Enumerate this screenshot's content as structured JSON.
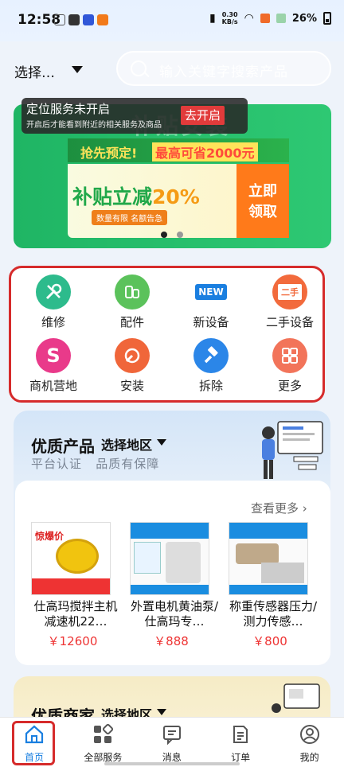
{
  "status_bar": {
    "time": "12:58",
    "speed": "0.30\nKB/s",
    "battery": "26%"
  },
  "top_bar": {
    "city_label": "选择…",
    "search_placeholder": "输入关键字搜索产品"
  },
  "banner": {
    "background_text": "补贴安装",
    "location_notice": {
      "title": "定位服务未开启",
      "subtitle": "开启后才能看到附近的相关服务及商品",
      "button": "去开启"
    },
    "promo_line_1": "抢先预定!",
    "promo_line_2": "最高可省2000元",
    "promo_main": "补贴立减",
    "promo_percent": "20%",
    "promo_note": "数量有限 名额告急",
    "promo_cta": "立即\n领取",
    "pages": 2,
    "active_page": 1
  },
  "services": [
    {
      "label": "维修",
      "icon": "wrench-icon",
      "color": "#2dbb8c"
    },
    {
      "label": "配件",
      "icon": "parts-icon",
      "color": "#5bc25b"
    },
    {
      "label": "新设备",
      "icon": "new-badge-icon",
      "color": "#1a7fe0"
    },
    {
      "label": "二手设备",
      "icon": "secondhand-icon",
      "color": "#f26a3c"
    },
    {
      "label": "商机营地",
      "icon": "shop-bag-icon",
      "color": "#e93a8a"
    },
    {
      "label": "安装",
      "icon": "install-icon",
      "color": "#f0663a"
    },
    {
      "label": "拆除",
      "icon": "hammer-icon",
      "color": "#2b86e8"
    },
    {
      "label": "更多",
      "icon": "more-grid-icon",
      "color": "#f2745a"
    }
  ],
  "quality_products": {
    "title": "优质产品",
    "region_label": "选择地区",
    "subtitle": "平台认证   品质有保障",
    "view_more": "查看更多",
    "items": [
      {
        "name": "仕高玛搅拌主机减速机22…",
        "price": "￥12600"
      },
      {
        "name": "外置电机黄油泵/仕高玛专…",
        "price": "￥888"
      },
      {
        "name": "称重传感器压力/测力传感…",
        "price": "￥800"
      }
    ]
  },
  "quality_merchants": {
    "title": "优质商家",
    "region_label": "选择地区"
  },
  "bottom_nav": [
    {
      "label": "首页",
      "icon": "home-icon",
      "active": true
    },
    {
      "label": "全部服务",
      "icon": "all-services-icon",
      "active": false
    },
    {
      "label": "消息",
      "icon": "message-icon",
      "active": false
    },
    {
      "label": "订单",
      "icon": "order-icon",
      "active": false
    },
    {
      "label": "我的",
      "icon": "profile-icon",
      "active": false
    }
  ]
}
